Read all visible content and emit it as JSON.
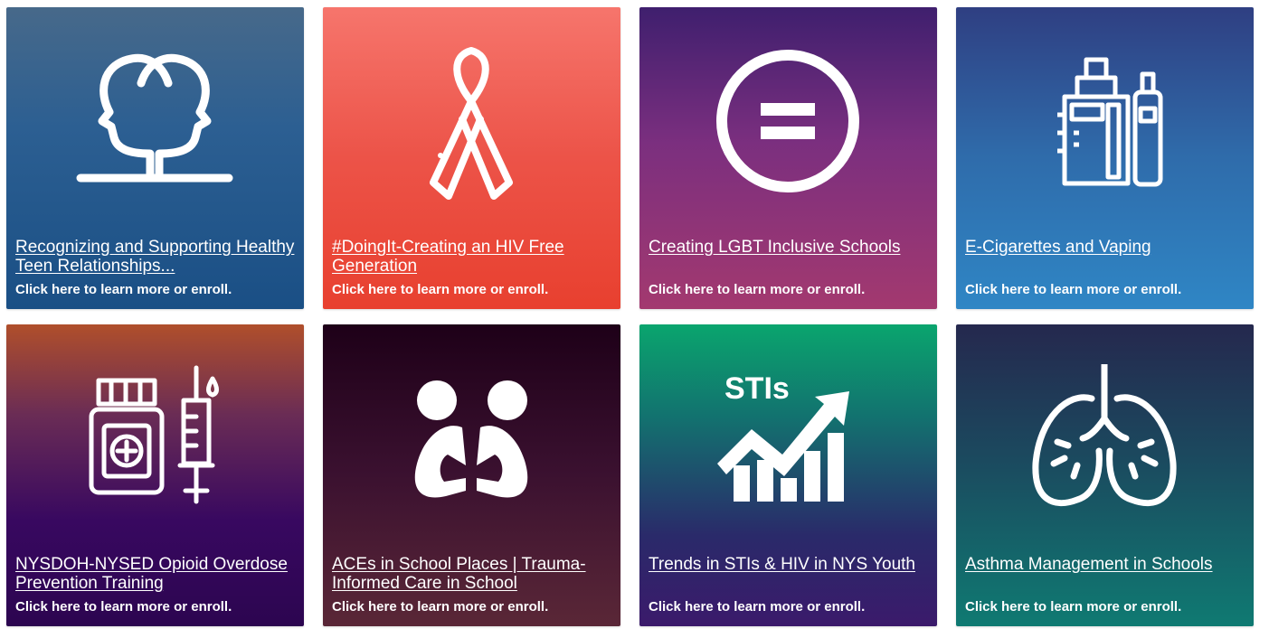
{
  "cards": [
    {
      "icon": "two-heads-icon",
      "title": "Recognizing and Supporting Healthy Teen Relationships...",
      "subtitle": "Click here to learn more or enroll."
    },
    {
      "icon": "awareness-ribbon-icon",
      "title": "#DoingIt-Creating an HIV Free Generation",
      "subtitle": "Click here to learn more or enroll."
    },
    {
      "icon": "equal-sign-icon",
      "title": "Creating LGBT Inclusive Schools",
      "subtitle": "Click here to learn more or enroll."
    },
    {
      "icon": "vape-device-icon",
      "title": "E-Cigarettes and Vaping",
      "subtitle": "Click here to learn more or enroll."
    },
    {
      "icon": "medicine-bottle-syringe-icon",
      "title": "NYSDOH-NYSED Opioid Overdose Prevention Training",
      "subtitle": "Click here to learn more or enroll."
    },
    {
      "icon": "sitting-people-icon",
      "title": "ACEs in School Places | Trauma-Informed Care in School",
      "subtitle": "Click here to learn more or enroll."
    },
    {
      "icon": "rising-chart-icon",
      "icon_text": "STIs",
      "title": "Trends in STIs & HIV in NYS Youth",
      "subtitle": "Click here to learn more or enroll."
    },
    {
      "icon": "lungs-icon",
      "title": "Asthma Management in Schools",
      "subtitle": "Click here to learn more or enroll."
    }
  ]
}
